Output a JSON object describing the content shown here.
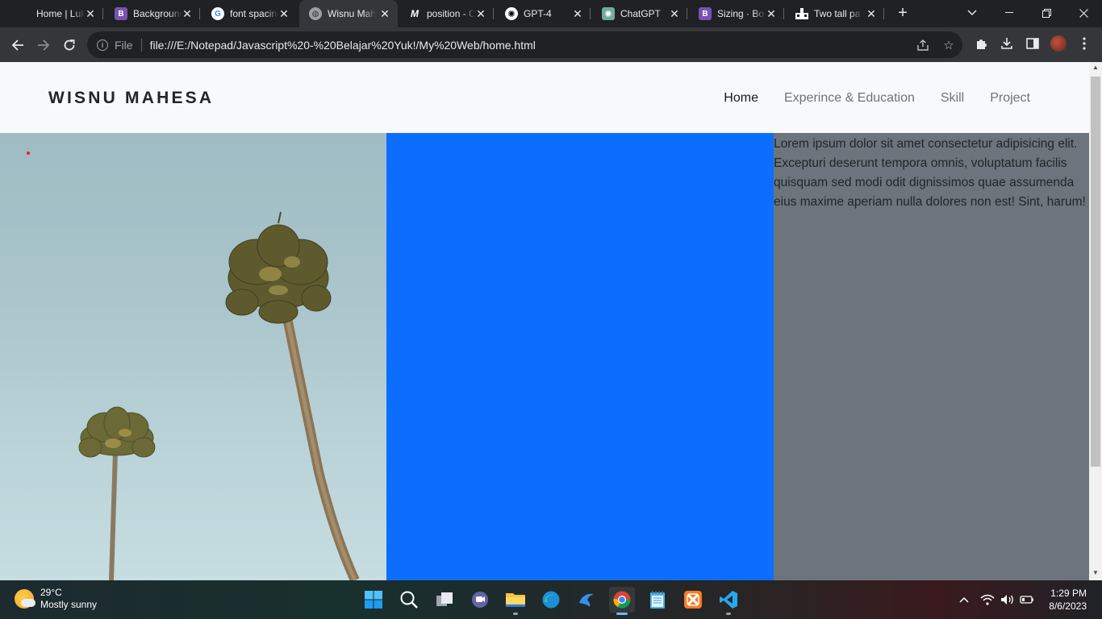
{
  "browser": {
    "tabs": [
      {
        "title": "Home | Luk",
        "favicon": "generic-icon",
        "active": false
      },
      {
        "title": "Background",
        "favicon": "bootstrap-icon",
        "active": false
      },
      {
        "title": "font spacing",
        "favicon": "google-icon",
        "active": false
      },
      {
        "title": "Wisnu Mahesa",
        "favicon": "globe-icon",
        "active": true
      },
      {
        "title": "position - C",
        "favicon": "medium-icon",
        "active": false
      },
      {
        "title": "GPT-4",
        "favicon": "openai-icon",
        "active": false
      },
      {
        "title": "ChatGPT",
        "favicon": "chatgpt-icon",
        "active": false
      },
      {
        "title": "Sizing · Boo",
        "favicon": "bootstrap-icon",
        "active": false
      },
      {
        "title": "Two tall pa",
        "favicon": "pixel-icon",
        "active": false
      }
    ],
    "address": {
      "scheme_label": "File",
      "url": "file:///E:/Notepad/Javascript%20-%20Belajar%20Yuk!/My%20Web/home.html"
    }
  },
  "site": {
    "brand": "WISNU MAHESA",
    "nav": [
      {
        "label": "Home",
        "active": true
      },
      {
        "label": "Experince & Education",
        "active": false
      },
      {
        "label": "Skill",
        "active": false
      },
      {
        "label": "Project",
        "active": false
      }
    ],
    "lorem": "Lorem ipsum dolor sit amet consectetur adipisicing elit. Excepturi deserunt tempora omnis, voluptatum facilis quisquam sed modi odit dignissimos quae assumenda eius maxime aperiam nulla dolores non est! Sint, harum!",
    "colors": {
      "primary": "#0d6efd",
      "secondary": "#6c757d",
      "navbar": "#f8f9fa"
    }
  },
  "taskbar": {
    "weather": {
      "temp": "29°C",
      "condition": "Mostly sunny"
    },
    "clock": {
      "time": "1:29 PM",
      "date": "8/6/2023"
    }
  }
}
